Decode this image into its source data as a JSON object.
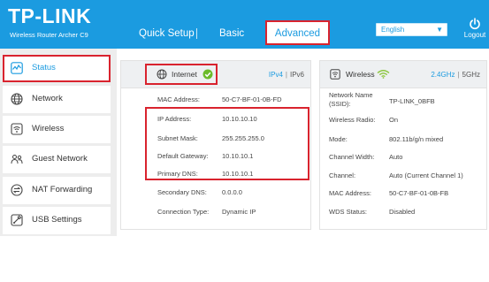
{
  "brand": {
    "logo": "TP-LINK",
    "model": "Wireless Router Archer C9"
  },
  "nav": {
    "quick_setup": "Quick Setup",
    "basic": "Basic",
    "advanced": "Advanced",
    "active": "Advanced"
  },
  "language": {
    "selected": "English"
  },
  "logout_label": "Logout",
  "sidebar": {
    "items": [
      {
        "label": "Status",
        "icon": "status-icon",
        "active": true
      },
      {
        "label": "Network",
        "icon": "globe-icon",
        "active": false
      },
      {
        "label": "Wireless",
        "icon": "wireless-icon",
        "active": false
      },
      {
        "label": "Guest Network",
        "icon": "guest-network-icon",
        "active": false
      },
      {
        "label": "NAT Forwarding",
        "icon": "nat-forwarding-icon",
        "active": false
      },
      {
        "label": "USB Settings",
        "icon": "usb-settings-icon",
        "active": false
      }
    ]
  },
  "internet": {
    "title": "Internet",
    "status": "connected",
    "proto_v4": "IPv4",
    "proto_v6": "IPv6",
    "rows": [
      {
        "label": "MAC Address:",
        "value": "50-C7-BF-01-0B-FD"
      },
      {
        "label": "IP Address:",
        "value": "10.10.10.10"
      },
      {
        "label": "Subnet Mask:",
        "value": "255.255.255.0"
      },
      {
        "label": "Default Gateway:",
        "value": "10.10.10.1"
      },
      {
        "label": "Primary DNS:",
        "value": "10.10.10.1"
      },
      {
        "label": "Secondary DNS:",
        "value": "0.0.0.0"
      },
      {
        "label": "Connection Type:",
        "value": "Dynamic IP"
      }
    ]
  },
  "wireless": {
    "title": "Wireless",
    "band_24": "2.4GHz",
    "band_5": "5GHz",
    "rows": [
      {
        "label": "Network Name",
        "label2": "(SSID):",
        "value": "TP-LINK_0BFB"
      },
      {
        "label": "Wireless Radio:",
        "value": "On"
      },
      {
        "label": "Mode:",
        "value": "802.11b/g/n mixed"
      },
      {
        "label": "Channel Width:",
        "value": "Auto"
      },
      {
        "label": "Channel:",
        "value": "Auto (Current Channel 1)"
      },
      {
        "label": "MAC Address:",
        "value": "50-C7-BF-01-0B-FB"
      },
      {
        "label": "WDS Status:",
        "value": "Disabled"
      }
    ]
  },
  "colors": {
    "header_blue": "#1b9be0",
    "highlight_red": "#d9232e",
    "status_green": "#6cbb2a",
    "wifi_green": "#8cc63f"
  }
}
